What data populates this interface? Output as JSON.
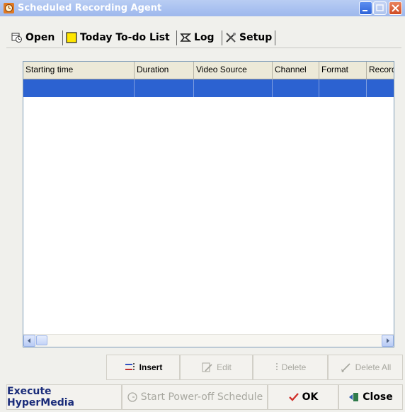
{
  "window": {
    "title": "Scheduled Recording Agent"
  },
  "tabs": [
    {
      "label": "Open",
      "icon": "open-schedule-icon",
      "selected": true
    },
    {
      "label": "Today To-do List",
      "icon": "yellow-note-icon",
      "selected": false
    },
    {
      "label": "Log",
      "icon": "log-icon",
      "selected": false
    },
    {
      "label": "Setup",
      "icon": "tools-icon",
      "selected": false
    }
  ],
  "table": {
    "columns": [
      "Starting time",
      "Duration",
      "Video Source",
      "Channel",
      "Format",
      "Record"
    ],
    "selected_row_color": "#2c62d1"
  },
  "actions": {
    "insert": "Insert",
    "edit": "Edit",
    "delete": "Delete",
    "delete_all": "Delete All"
  },
  "footer": {
    "execute": "Execute HyperMedia",
    "start_poweroff": "Start Power-off Schedule",
    "ok": "OK",
    "close": "Close"
  },
  "colors": {
    "titlebar": "#a8c0f0",
    "accent_selection": "#2c62d1",
    "disabled_text": "#a8a8a0"
  }
}
